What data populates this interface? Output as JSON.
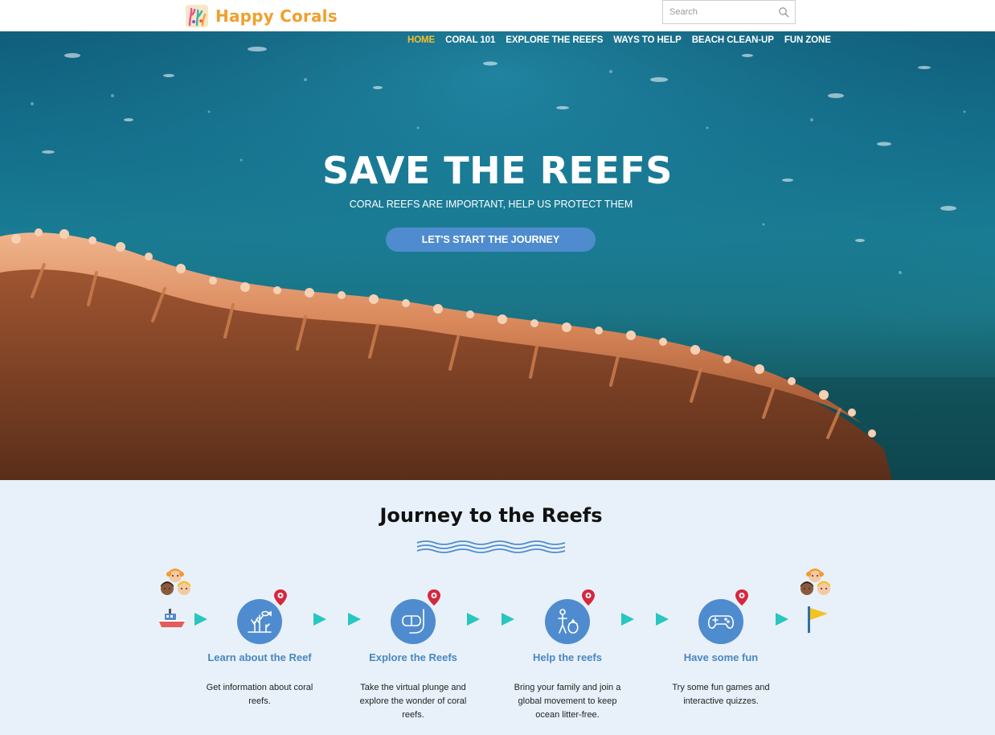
{
  "brand": {
    "name": "Happy Corals",
    "logo_icon": "coral-logo-icon"
  },
  "search": {
    "placeholder": "Search",
    "value": ""
  },
  "nav": {
    "items": [
      {
        "label": "HOME",
        "active": true
      },
      {
        "label": "CORAL 101",
        "active": false
      },
      {
        "label": "EXPLORE THE REEFS",
        "active": false
      },
      {
        "label": "WAYS TO HELP",
        "active": false
      },
      {
        "label": "BEACH CLEAN-UP",
        "active": false
      },
      {
        "label": "FUN ZONE",
        "active": false
      }
    ]
  },
  "hero": {
    "title": "SAVE THE REEFS",
    "subtitle": "CORAL REEFS ARE IMPORTANT, HELP US PROTECT THEM",
    "button": "LET'S START THE JOURNEY"
  },
  "journey": {
    "title": "Journey to the Reefs",
    "steps": [
      {
        "title": "Learn about the Reef",
        "description": "Get information about coral reefs.",
        "icon": "coral-reef-icon"
      },
      {
        "title": "Explore the Reefs",
        "description": "Take the virtual plunge and explore the wonder of  coral reefs.",
        "icon": "snorkel-mask-icon"
      },
      {
        "title": "Help the reefs",
        "description": "Bring your family and join a global movement to keep ocean litter-free.",
        "icon": "trash-collector-icon"
      },
      {
        "title": "Have some fun",
        "description": "Try some fun games and interactive quizzes.",
        "icon": "gamepad-icon"
      }
    ]
  },
  "colors": {
    "brand_orange": "#f0a02e",
    "nav_active": "#f6c02e",
    "accent_blue": "#4f8ccf",
    "arrow_teal": "#27c6c0",
    "journey_bg": "#e8f1f9"
  }
}
